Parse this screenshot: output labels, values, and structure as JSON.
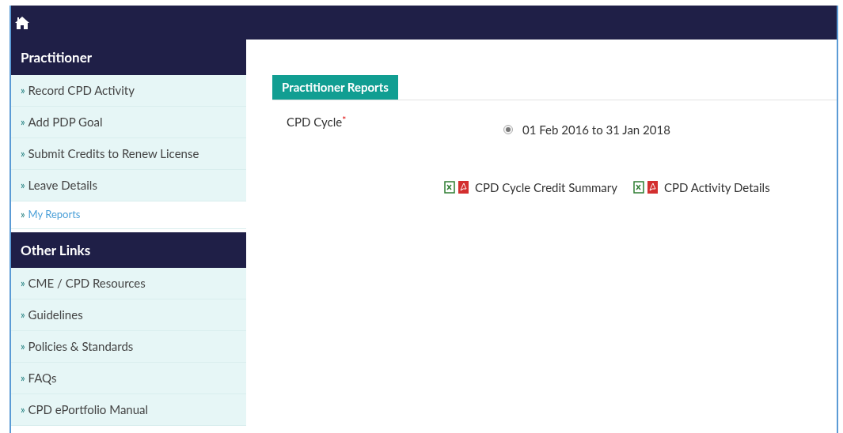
{
  "sidebar": {
    "sections": [
      {
        "title": "Practitioner",
        "items": [
          {
            "bullet": "»",
            "label": "Record CPD Activity",
            "selected": false
          },
          {
            "bullet": "»",
            "label": "Add PDP Goal",
            "selected": false
          },
          {
            "bullet": "»",
            "label": "Submit Credits to Renew License",
            "selected": false
          },
          {
            "bullet": "»",
            "label": "Leave Details",
            "selected": false
          },
          {
            "bullet": "»",
            "label": "My Reports",
            "selected": true
          }
        ]
      },
      {
        "title": "Other Links",
        "items": [
          {
            "bullet": "»",
            "label": "CME / CPD Resources",
            "selected": false
          },
          {
            "bullet": "»",
            "label": "Guidelines",
            "selected": false
          },
          {
            "bullet": "»",
            "label": "Policies & Standards",
            "selected": false
          },
          {
            "bullet": "»",
            "label": "FAQs",
            "selected": false
          },
          {
            "bullet": "»",
            "label": "CPD ePortfolio Manual",
            "selected": false
          }
        ]
      }
    ]
  },
  "panel": {
    "title": "Practitioner Reports",
    "field": {
      "label": "CPD Cycle",
      "required_mark": "*",
      "options": [
        {
          "label": "01 Feb 2016 to 31 Jan 2018",
          "selected": true
        }
      ]
    },
    "reports": [
      {
        "label": "CPD Cycle Credit Summary"
      },
      {
        "label": "CPD Activity Details"
      }
    ]
  }
}
